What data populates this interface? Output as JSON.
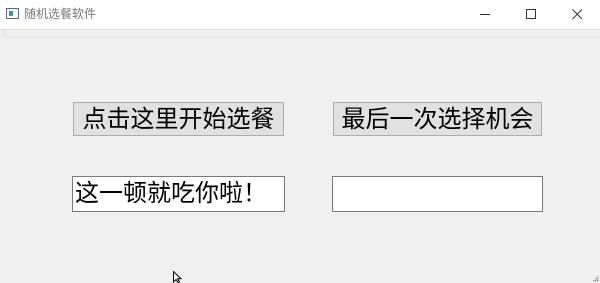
{
  "window": {
    "title": "随机选餐软件",
    "icon": "app-window-icon",
    "controls": [
      "minimize-icon",
      "maximize-icon",
      "close-icon"
    ]
  },
  "buttons": {
    "start_label": "点击这里开始选餐",
    "last_chance_label": "最后一次选择机会"
  },
  "fields": {
    "result_text": "这一顿就吃你啦！",
    "second_text": ""
  }
}
